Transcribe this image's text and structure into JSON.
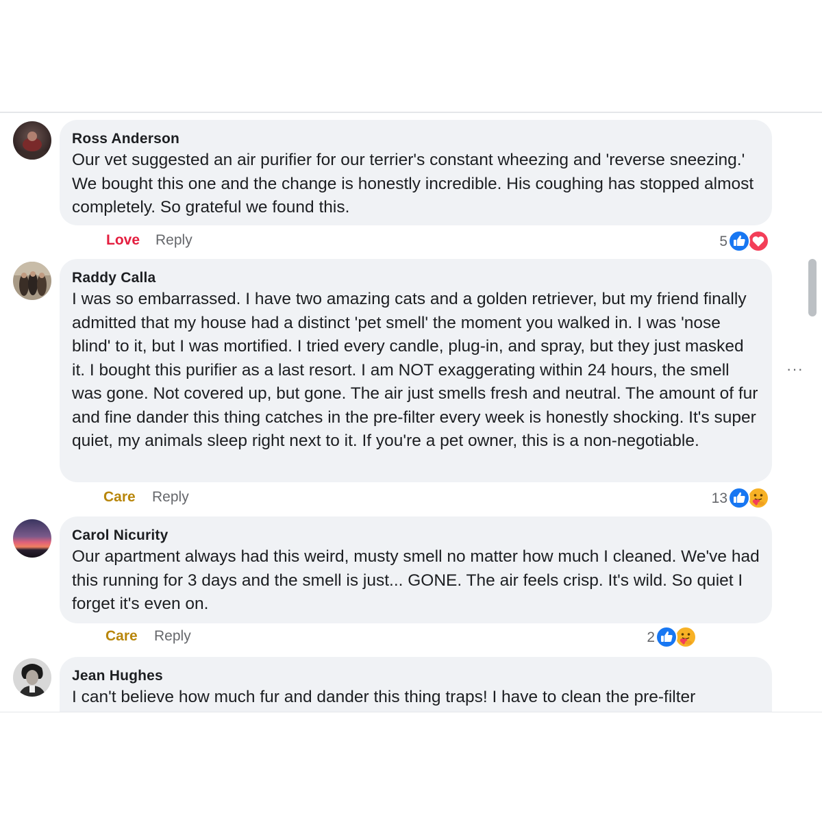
{
  "comments": [
    {
      "author": "Ross Anderson",
      "text": "Our vet suggested an air purifier for our terrier's constant wheezing and 'reverse sneezing.' We bought this one and the change is honestly incredible. His coughing has stopped almost completely. So grateful we found this.",
      "reaction_label": "Love",
      "reply_label": "Reply",
      "reaction_count": "5",
      "reaction_color": "#e41e3f"
    },
    {
      "author": "Raddy Calla",
      "text": "I was so embarrassed. I have two amazing cats and a golden retriever, but my friend finally admitted that my house had a distinct 'pet smell' the moment you walked in. I was 'nose blind' to it, but I was mortified. I tried every candle, plug-in, and spray, but they just masked it. I bought this purifier as a last resort. I am NOT exaggerating within 24 hours, the smell was gone. Not covered up, but gone. The air just smells fresh and neutral. The amount of fur and fine dander this thing catches in the pre-filter every week is honestly shocking. It's super quiet, my animals sleep right next to it. If you're a pet owner, this is a non-negotiable.",
      "reaction_label": "Care",
      "reply_label": "Reply",
      "reaction_count": "13",
      "reaction_color": "#b8860b"
    },
    {
      "author": "Carol Nicurity",
      "text": "Our apartment always had this weird, musty smell no matter how much I cleaned. We've had this running for 3 days and the smell is just... GONE. The air feels crisp. It's wild. So quiet I forget it's even on.",
      "reaction_label": "Care",
      "reply_label": "Reply",
      "reaction_count": "2",
      "reaction_color": "#b8860b"
    },
    {
      "author": "Jean Hughes",
      "text": "I can't believe how much fur and dander this thing traps! I have to clean the pre-filter"
    }
  ],
  "more_options": "···",
  "colors": {
    "like_blue": "#1877f2",
    "love_red": "#f33e58",
    "care_yellow": "#f7b125",
    "bubble_bg": "#f0f2f5"
  }
}
